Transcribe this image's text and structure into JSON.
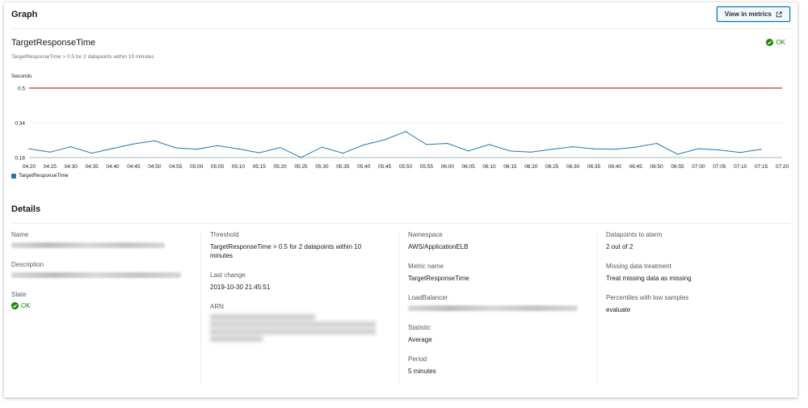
{
  "graph": {
    "title": "Graph",
    "view_metrics_label": "View in metrics",
    "metric_title": "TargetResponseTime",
    "metric_subtitle": "TargetResponseTime > 0.5 for 2 datapoints within 10 minutes",
    "state": "OK"
  },
  "chart_data": {
    "type": "line",
    "ylabel": "Seconds",
    "yticks": [
      "0.5",
      "0.34",
      "0.18"
    ],
    "ylim": [
      0.18,
      0.5
    ],
    "threshold": 0.5,
    "threshold_color": "#d13212",
    "series_color": "#1f77b4",
    "x": [
      "04:20",
      "04:25",
      "04:30",
      "04:35",
      "04:40",
      "04:45",
      "04:50",
      "04:55",
      "05:00",
      "05:05",
      "05:10",
      "05:15",
      "05:20",
      "05:25",
      "05:30",
      "05:35",
      "05:40",
      "05:45",
      "05:50",
      "05:55",
      "06:00",
      "06:05",
      "06:10",
      "06:15",
      "06:20",
      "06:25",
      "06:30",
      "06:35",
      "06:40",
      "06:45",
      "06:50",
      "06:55",
      "07:00",
      "07:05",
      "07:10",
      "07:15",
      "07:20"
    ],
    "series": [
      {
        "name": "TargetResponseTime",
        "values": [
          0.22,
          0.205,
          0.23,
          0.2,
          0.222,
          0.243,
          0.257,
          0.225,
          0.218,
          0.235,
          0.22,
          0.202,
          0.226,
          0.18,
          0.228,
          0.2,
          0.238,
          0.262,
          0.3,
          0.24,
          0.245,
          0.21,
          0.24,
          0.21,
          0.205,
          0.218,
          0.23,
          0.22,
          0.218,
          0.228,
          0.245,
          0.195,
          0.221,
          0.215,
          0.203,
          0.218,
          null
        ]
      }
    ]
  },
  "details": {
    "title": "Details",
    "name_label": "Name",
    "description_label": "Description",
    "state_label": "State",
    "state_value": "OK",
    "threshold_label": "Threshold",
    "threshold_value": "TargetResponseTime > 0.5 for 2 datapoints within 10 minutes",
    "last_change_label": "Last change",
    "last_change_value": "2019-10-30 21:45:51",
    "arn_label": "ARN",
    "namespace_label": "Namespace",
    "namespace_value": "AWS/ApplicationELB",
    "metric_name_label": "Metric name",
    "metric_name_value": "TargetResponseTime",
    "load_balancer_label": "LoadBalancer",
    "statistic_label": "Statistic",
    "statistic_value": "Average",
    "period_label": "Period",
    "period_value": "5 minutes",
    "datapoints_label": "Datapoints to alarm",
    "datapoints_value": "2 out of 2",
    "missing_label": "Missing data treatment",
    "missing_value": "Treat missing data as missing",
    "percentiles_label": "Percentiles with low samples",
    "percentiles_value": "evaluate"
  }
}
